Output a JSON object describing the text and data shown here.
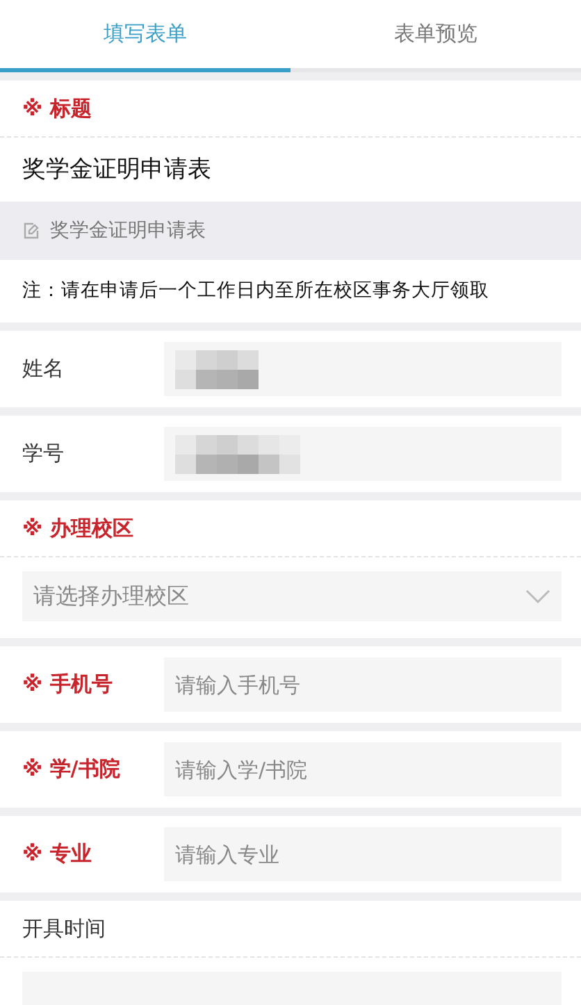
{
  "tabs": [
    {
      "label": "填写表单",
      "selected": true
    },
    {
      "label": "表单预览",
      "selected": false
    }
  ],
  "title_section": {
    "label": "※ 标题",
    "required": true,
    "value": "奖学金证明申请表",
    "subtitle": "奖学金证明申请表",
    "note": "注：请在申请后一个工作日内至所在校区事务大厅领取"
  },
  "fields": [
    {
      "kind": "inline",
      "label": "姓名",
      "required": false,
      "redacted": true
    },
    {
      "kind": "inline",
      "label": "学号",
      "required": false,
      "redacted": true
    },
    {
      "kind": "select",
      "label": "※ 办理校区",
      "required": true,
      "placeholder": "请选择办理校区"
    },
    {
      "kind": "inline",
      "label": "※ 手机号",
      "required": true,
      "placeholder": "请输入手机号"
    },
    {
      "kind": "inline",
      "label": "※ 学/书院",
      "required": true,
      "placeholder": "请输入学/书院"
    },
    {
      "kind": "inline",
      "label": "※ 专业",
      "required": true,
      "placeholder": "请输入专业"
    },
    {
      "kind": "stacked",
      "label": "开具时间",
      "required": false
    }
  ]
}
